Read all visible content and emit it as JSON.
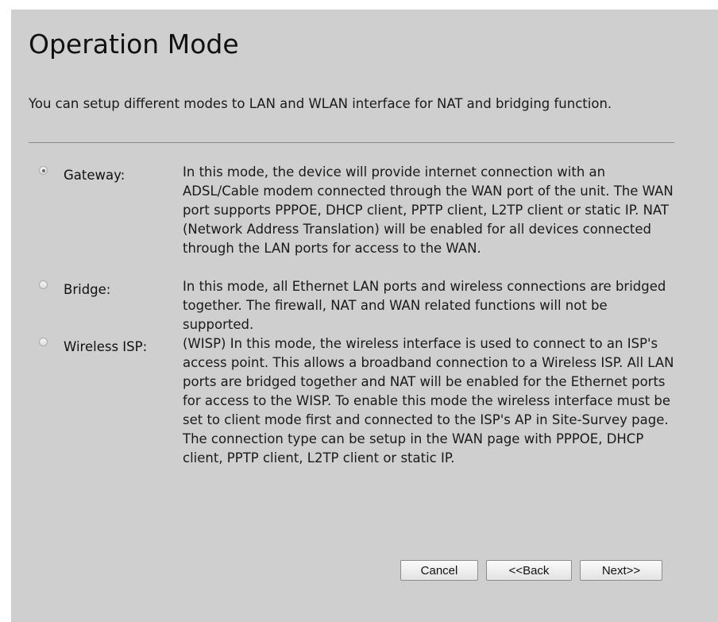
{
  "page": {
    "title": "Operation Mode",
    "intro": "You can setup different modes to LAN and WLAN interface for NAT and bridging function."
  },
  "modes": [
    {
      "label": "Gateway:",
      "selected": true,
      "description": "In this mode, the device will provide internet connection with an ADSL/Cable modem connected through the WAN port of the unit. The WAN port supports PPPOE, DHCP client, PPTP client, L2TP client or static IP. NAT (Network Address Translation) will be enabled for all devices connected through the LAN ports for access to the WAN."
    },
    {
      "label": "Bridge:",
      "selected": false,
      "description": "In this mode, all Ethernet LAN ports and wireless connections are bridged together. The firewall, NAT and WAN related functions will not be supported."
    },
    {
      "label": "Wireless ISP:",
      "selected": false,
      "description": "(WISP) In this mode, the wireless interface is used to connect to an ISP's access point. This allows a broadband connection to a Wireless ISP. All LAN ports are bridged together and NAT will be enabled for the Ethernet ports for access to the WISP. To enable this mode the wireless interface must be set to client mode first and connected to the ISP's AP in Site-Survey page. The connection type can be setup in the WAN page with PPPOE, DHCP client, PPTP client, L2TP client or static IP."
    }
  ],
  "buttons": {
    "cancel": "Cancel",
    "back": "<<Back",
    "next": "Next>>"
  },
  "colors": {
    "panel_background": "#cfcfcf",
    "page_background": "#ffffff"
  }
}
